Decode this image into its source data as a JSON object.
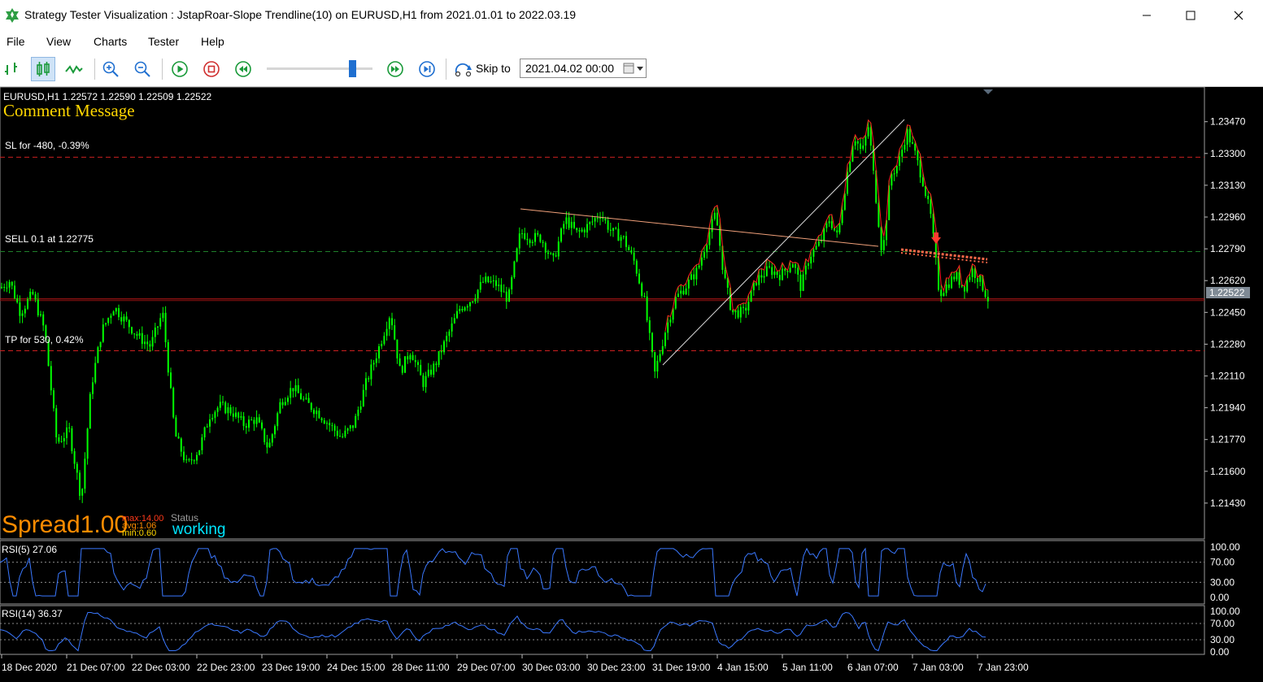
{
  "window": {
    "title": "Strategy Tester Visualization : JstapRoar-Slope Trendline(10) on EURUSD,H1 from 2021.01.01 to 2022.03.19",
    "controls": {
      "minimize": "—",
      "maximize": "☐",
      "close": "✕"
    }
  },
  "menu": [
    "File",
    "View",
    "Charts",
    "Tester",
    "Help"
  ],
  "toolbar": {
    "skip_label": "Skip to",
    "skip_value": "2021.04.02 00:00",
    "speed_level": 0.78,
    "icons": [
      "bar-chart-icon",
      "candlestick-icon",
      "line-chart-icon",
      "zoom-in-icon",
      "zoom-out-icon",
      "play-icon",
      "stop-icon",
      "rewind-icon",
      "fast-forward-icon",
      "skip-end-icon",
      "skip-to-icon",
      "calendar-icon"
    ]
  },
  "colors": {
    "candle": "#00ff00",
    "price_line": "#ff0000",
    "rsi": "#3a78ff",
    "comment": "#ffd700",
    "spread": "#ff8c00",
    "working": "#00e5ff",
    "level_line": "#cc2020"
  },
  "main_chart": {
    "info": "EURUSD,H1  1.22572 1.22590 1.22509 1.22522",
    "comment": "Comment Message",
    "levels": [
      {
        "label": "SL for -480, -0.39%",
        "price": 1.2328
      },
      {
        "label": "SELL 0.1 at 1.22775",
        "price": 1.22775
      },
      {
        "label": "TP for 530, 0.42%",
        "price": 1.22245
      }
    ],
    "current_price": "1.22522",
    "spread_label": "Spread",
    "spread_value": "1.00",
    "spread_max": "max:14.00",
    "spread_avg": "avg:1.06",
    "spread_min": "min:0.60",
    "status_label": "Status",
    "status_value": "working",
    "price_ticks": [
      "1.23470",
      "1.23300",
      "1.23130",
      "1.22960",
      "1.22790",
      "1.22620",
      "1.22450",
      "1.22280",
      "1.22110",
      "1.21940",
      "1.21770",
      "1.21600",
      "1.21430"
    ]
  },
  "rsi5": {
    "label": "RSI(5) 27.06",
    "ticks": [
      "100.00",
      "70.00",
      "30.00",
      "0.00"
    ]
  },
  "rsi14": {
    "label": "RSI(14) 36.37",
    "ticks": [
      "100.00",
      "70.00",
      "30.00",
      "0.00"
    ]
  },
  "time_ticks": [
    "18 Dec 2020",
    "21 Dec 07:00",
    "22 Dec 03:00",
    "22 Dec 23:00",
    "23 Dec 19:00",
    "24 Dec 15:00",
    "28 Dec 11:00",
    "29 Dec 07:00",
    "30 Dec 03:00",
    "30 Dec 23:00",
    "31 Dec 19:00",
    "4 Jan 15:00",
    "5 Jan 11:00",
    "6 Jan 07:00",
    "7 Jan 03:00",
    "7 Jan 23:00"
  ],
  "chart_data": {
    "type": "candlestick",
    "title": "EURUSD,H1",
    "anchors": [
      [
        0,
        1.2258
      ],
      [
        12,
        1.2262
      ],
      [
        25,
        1.2245
      ],
      [
        40,
        1.2255
      ],
      [
        55,
        1.2235
      ],
      [
        70,
        1.2175
      ],
      [
        85,
        1.2182
      ],
      [
        100,
        1.2145
      ],
      [
        112,
        1.2205
      ],
      [
        125,
        1.2235
      ],
      [
        140,
        1.2248
      ],
      [
        155,
        1.224
      ],
      [
        170,
        1.2232
      ],
      [
        185,
        1.2227
      ],
      [
        200,
        1.2245
      ],
      [
        215,
        1.218
      ],
      [
        230,
        1.2163
      ],
      [
        245,
        1.2172
      ],
      [
        258,
        1.219
      ],
      [
        270,
        1.2195
      ],
      [
        285,
        1.2192
      ],
      [
        300,
        1.2185
      ],
      [
        315,
        1.2188
      ],
      [
        330,
        1.2172
      ],
      [
        345,
        1.2197
      ],
      [
        360,
        1.2205
      ],
      [
        375,
        1.2197
      ],
      [
        390,
        1.2192
      ],
      [
        405,
        1.2185
      ],
      [
        420,
        1.2178
      ],
      [
        435,
        1.2185
      ],
      [
        450,
        1.2207
      ],
      [
        465,
        1.2225
      ],
      [
        480,
        1.2245
      ],
      [
        492,
        1.2213
      ],
      [
        505,
        1.2225
      ],
      [
        520,
        1.2207
      ],
      [
        535,
        1.2217
      ],
      [
        550,
        1.2232
      ],
      [
        565,
        1.2247
      ],
      [
        580,
        1.2252
      ],
      [
        595,
        1.2262
      ],
      [
        610,
        1.226
      ],
      [
        625,
        1.2252
      ],
      [
        640,
        1.2288
      ],
      [
        652,
        1.2285
      ],
      [
        665,
        1.2285
      ],
      [
        680,
        1.2272
      ],
      [
        695,
        1.2295
      ],
      [
        710,
        1.2287
      ],
      [
        725,
        1.2292
      ],
      [
        738,
        1.2298
      ],
      [
        752,
        1.2288
      ],
      [
        766,
        1.2285
      ],
      [
        780,
        1.2272
      ],
      [
        792,
        1.2252
      ],
      [
        805,
        1.2212
      ],
      [
        818,
        1.2235
      ],
      [
        830,
        1.2252
      ],
      [
        845,
        1.226
      ],
      [
        858,
        1.2268
      ],
      [
        870,
        1.2285
      ],
      [
        880,
        1.2298
      ],
      [
        890,
        1.2265
      ],
      [
        900,
        1.2245
      ],
      [
        915,
        1.2245
      ],
      [
        930,
        1.2262
      ],
      [
        945,
        1.2268
      ],
      [
        960,
        1.2265
      ],
      [
        975,
        1.2272
      ],
      [
        985,
        1.2258
      ],
      [
        995,
        1.2275
      ],
      [
        1008,
        1.2282
      ],
      [
        1020,
        1.2295
      ],
      [
        1030,
        1.2285
      ],
      [
        1040,
        1.2315
      ],
      [
        1050,
        1.234
      ],
      [
        1060,
        1.233
      ],
      [
        1068,
        1.2345
      ],
      [
        1075,
        1.2315
      ],
      [
        1085,
        1.2275
      ],
      [
        1095,
        1.2318
      ],
      [
        1105,
        1.2325
      ],
      [
        1115,
        1.2342
      ],
      [
        1125,
        1.233
      ],
      [
        1135,
        1.2315
      ],
      [
        1145,
        1.2295
      ],
      [
        1155,
        1.2255
      ],
      [
        1165,
        1.226
      ],
      [
        1175,
        1.2265
      ],
      [
        1185,
        1.2258
      ],
      [
        1195,
        1.2268
      ],
      [
        1205,
        1.2262
      ],
      [
        1215,
        1.2252
      ]
    ],
    "ylim": [
      1.2136,
      1.2356
    ],
    "rsi5_range": [
      0,
      100
    ],
    "rsi14_range": [
      0,
      100
    ],
    "last_rsi5": 27.06,
    "last_rsi14": 36.37,
    "sell_price": 1.22775,
    "sl_price": 1.2328,
    "tp_price": 1.22245
  }
}
